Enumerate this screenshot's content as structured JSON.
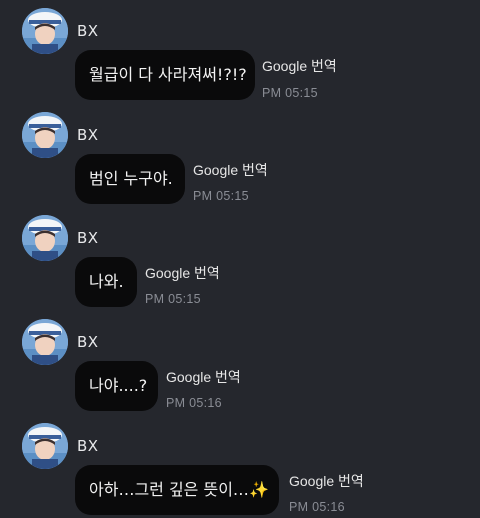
{
  "messages": [
    {
      "sender": "BX",
      "text": "월급이 다 사라져써!?!?",
      "translator": "Google 번역",
      "time": "PM 05:15"
    },
    {
      "sender": "BX",
      "text": "범인 누구야.",
      "translator": "Google 번역",
      "time": "PM 05:15"
    },
    {
      "sender": "BX",
      "text": "나와.",
      "translator": "Google 번역",
      "time": "PM 05:15"
    },
    {
      "sender": "BX",
      "text": "나야....?",
      "translator": "Google 번역",
      "time": "PM 05:16"
    },
    {
      "sender": "BX",
      "text": "아하…그런 깊은 뜻이…",
      "emoji": "✨",
      "translator": "Google 번역",
      "time": "PM 05:16"
    }
  ],
  "colors": {
    "background": "#25272d",
    "bubble": "#0a0a0b",
    "time_text": "#8a8d95",
    "sparkle": "#f2c93a"
  },
  "icons": {
    "avatar": "profile-photo-sailor-hat",
    "emoji": "sparkles"
  }
}
